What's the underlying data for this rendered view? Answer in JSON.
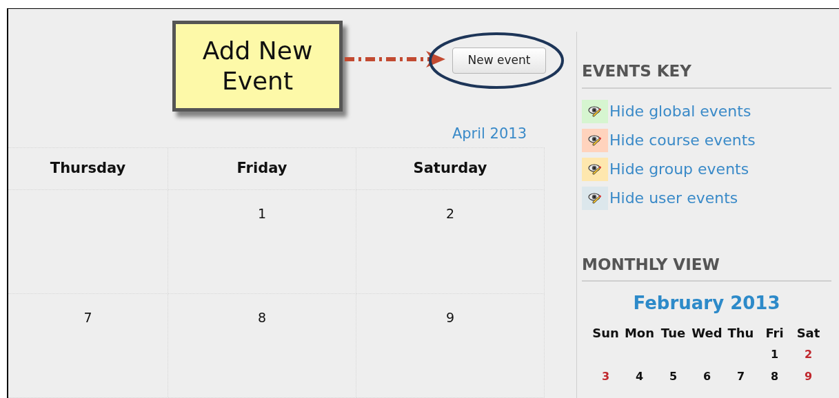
{
  "callout": {
    "text": "Add New Event"
  },
  "new_event_button": "New event",
  "month_link": "April 2013",
  "calendar": {
    "columns": [
      "Thursday",
      "Friday",
      "Saturday"
    ],
    "rows": [
      [
        "",
        "1",
        "2"
      ],
      [
        "7",
        "8",
        "9"
      ]
    ]
  },
  "events_key": {
    "title": "EVENTS KEY",
    "items": [
      {
        "label": "Hide global events",
        "color": "#d6f5d0"
      },
      {
        "label": "Hide course events",
        "color": "#ffd3bd"
      },
      {
        "label": "Hide group events",
        "color": "#fee7ae"
      },
      {
        "label": "Hide user events",
        "color": "#dce7ec"
      }
    ]
  },
  "monthly_view": {
    "title": "MONTHLY VIEW",
    "month": "February 2013",
    "weekdays": [
      "Sun",
      "Mon",
      "Tue",
      "Wed",
      "Thu",
      "Fri",
      "Sat"
    ],
    "weeks": [
      [
        {
          "day": "1",
          "weekend": false
        },
        {
          "day": "2",
          "weekend": true
        }
      ],
      [
        {
          "day": "3",
          "weekend": true
        },
        {
          "day": "4",
          "weekend": false
        },
        {
          "day": "5",
          "weekend": false
        },
        {
          "day": "6",
          "weekend": false
        },
        {
          "day": "7",
          "weekend": false
        },
        {
          "day": "8",
          "weekend": false
        },
        {
          "day": "9",
          "weekend": true
        }
      ]
    ]
  }
}
